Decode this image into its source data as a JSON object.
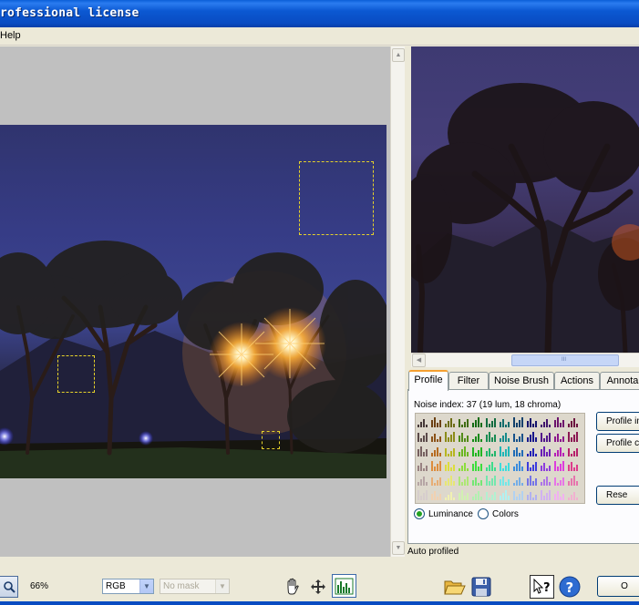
{
  "window": {
    "title": "rofessional license"
  },
  "menu": {
    "help_label": "Help"
  },
  "right_panel": {
    "tabs": [
      "Profile",
      "Filter",
      "Noise Brush",
      "Actions",
      "Annota"
    ],
    "noise_index": "Noise index:  37 (19 lum, 18 chroma)",
    "buttons": {
      "profile_image": "Profile im",
      "profile_color": "Profile c",
      "reset": "Rese"
    },
    "radios": {
      "luminance": "Luminance",
      "colors": "Colors",
      "selected": "Luminance"
    },
    "status": "Auto profiled",
    "scrollbar_grip": "III"
  },
  "bottom_toolbar": {
    "zoom": "66%",
    "channel": "RGB",
    "mask": "No mask",
    "ok_label": "O"
  },
  "icons": {
    "zoom": "magnifier-icon",
    "hand": "hand-pan-icon",
    "move": "move-cross-icon",
    "histogram": "histogram-icon",
    "open": "folder-open-icon",
    "save": "save-disk-icon",
    "context_help": "context-help-icon",
    "help": "help-circle-icon"
  },
  "colors": {
    "titlebar": "#0a4cc2",
    "accent_green": "#21a121",
    "tab_highlight": "#f5a030"
  }
}
